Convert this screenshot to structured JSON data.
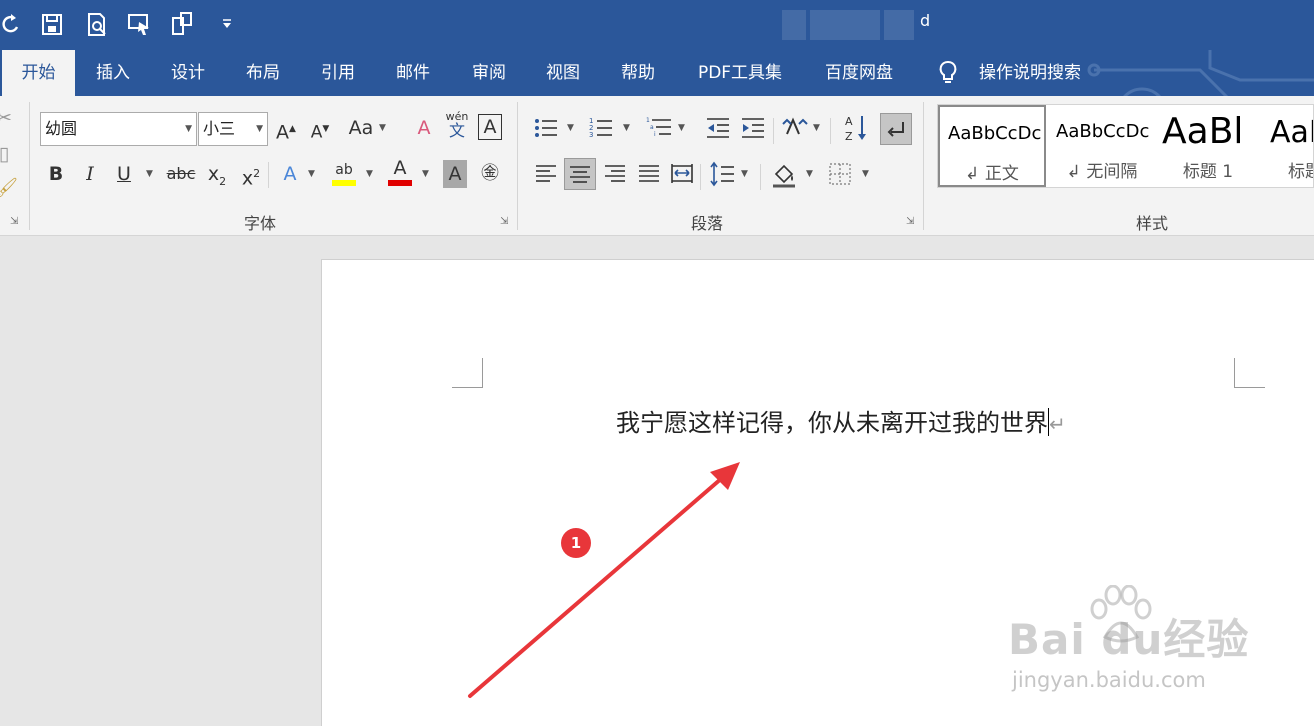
{
  "title": "d",
  "tabs": [
    "开始",
    "插入",
    "设计",
    "布局",
    "引用",
    "邮件",
    "审阅",
    "视图",
    "帮助",
    "PDF工具集",
    "百度网盘"
  ],
  "tell_me": "操作说明搜索",
  "font": {
    "name": "幼圆",
    "size": "小三",
    "aa": "Aa",
    "phonetic": "wén",
    "phonetic_char": "文",
    "group_label": "字体"
  },
  "paragraph": {
    "group_label": "段落"
  },
  "styles": {
    "group_label": "样式",
    "items": [
      {
        "sample": "AaBbCcDc",
        "name": "正文"
      },
      {
        "sample": "AaBbCcDc",
        "name": "无间隔"
      },
      {
        "sample": "AaBl",
        "name": "标题 1"
      },
      {
        "sample": "AaI",
        "name": "标题"
      }
    ]
  },
  "document": {
    "text": "我宁愿这样记得，你从未离开过我的世界"
  },
  "annotation": {
    "badge": "1",
    "color": "#e8363a"
  },
  "watermark": {
    "brand": "Bai du经验",
    "url": "jingyan.baidu.com"
  },
  "colors": {
    "ribbon_blue": "#2b579a",
    "highlight": "#ffff00",
    "font_color": "#e00000"
  }
}
